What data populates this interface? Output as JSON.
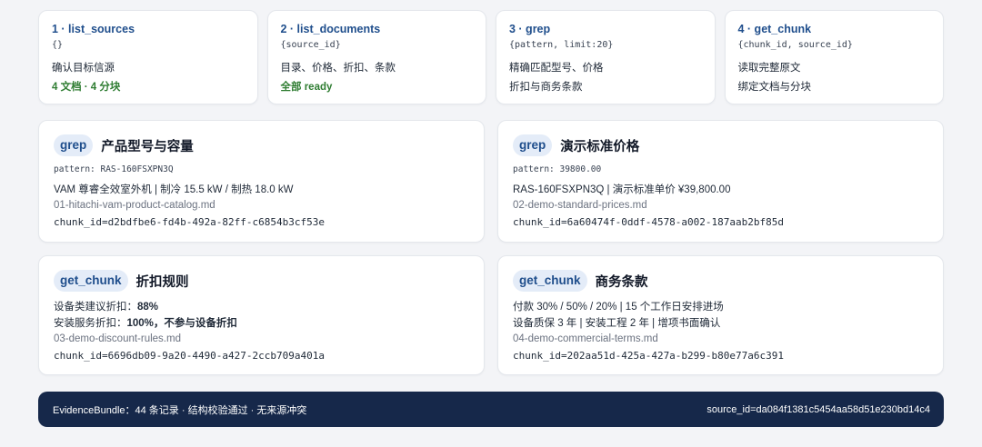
{
  "steps": [
    {
      "title": "1 · list_sources",
      "args": "{}",
      "line1": "确认目标信源",
      "line2": "4 文档 · 4 分块"
    },
    {
      "title": "2 · list_documents",
      "args": "{source_id}",
      "line1": "目录、价格、折扣、条款",
      "line2": "全部 ready"
    },
    {
      "title": "3 · grep",
      "args": "{pattern, limit:20}",
      "line1": "精确匹配型号、价格",
      "line2": "折扣与商务条款"
    },
    {
      "title": "4 · get_chunk",
      "args": "{chunk_id, source_id}",
      "line1": "读取完整原文",
      "line2": "绑定文档与分块"
    }
  ],
  "cards": {
    "model": {
      "tag": "grep",
      "title": "产品型号与容量",
      "pattern": "pattern: RAS-160FSXPN3Q",
      "line1": "VAM 尊睿全效室外机 | 制冷 15.5 kW / 制热 18.0 kW",
      "file": "01-hitachi-vam-product-catalog.md",
      "chunk": "chunk_id=d2bdfbe6-fd4b-492a-82ff-c6854b3cf53e"
    },
    "price": {
      "tag": "grep",
      "title": "演示标准价格",
      "pattern": "pattern: 39800.00",
      "line1": "RAS-160FSXPN3Q | 演示标准单价 ¥39,800.00",
      "file": "02-demo-standard-prices.md",
      "chunk": "chunk_id=6a60474f-0ddf-4578-a002-187aab2bf85d"
    },
    "discount": {
      "tag": "get_chunk",
      "title": "折扣规则",
      "line1_label": "设备类建议折扣：",
      "line1_value": "88%",
      "line2_label": "安装服务折扣：",
      "line2_value": "100%，不参与设备折扣",
      "file": "03-demo-discount-rules.md",
      "chunk": "chunk_id=6696db09-9a20-4490-a427-2ccb709a401a"
    },
    "terms": {
      "tag": "get_chunk",
      "title": "商务条款",
      "line1": "付款 30% / 50% / 20% | 15 个工作日安排进场",
      "line2": "设备质保 3 年 | 安装工程 2 年 | 增项书面确认",
      "file": "04-demo-commercial-terms.md",
      "chunk": "chunk_id=202aa51d-425a-427a-b299-b80e77a6c391"
    }
  },
  "footer": {
    "left": "EvidenceBundle：44 条记录 · 结构校验通过 · 无来源冲突",
    "right": "source_id=da084f1381c5454aa58d51e230bd14c4"
  }
}
